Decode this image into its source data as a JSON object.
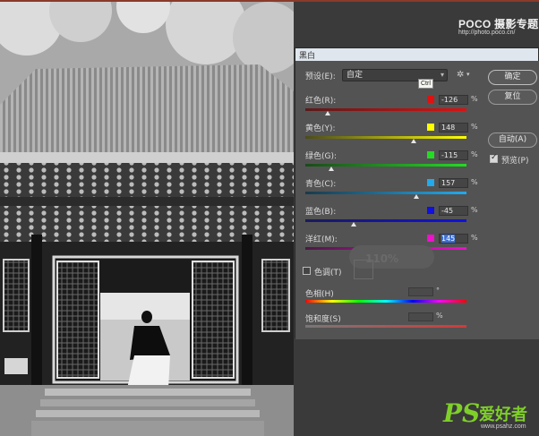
{
  "watermark": {
    "poco": "POCO 摄影专题",
    "url": "http://photo.poco.cn/",
    "ps_logo": "PS",
    "ps_cn": "爱好者",
    "ps_site": "www.psahz.com"
  },
  "dialog": {
    "title": "黑白",
    "preset_label": "预设(E):",
    "preset_value": "自定",
    "tooltip": "Ctrl",
    "buttons": {
      "ok": "确定",
      "reset": "复位",
      "auto": "自动(A)"
    },
    "preview_label": "预览(P)",
    "preview_checked": true,
    "sliders": [
      {
        "label": "红色(R):",
        "value": "-126",
        "unit": "%",
        "color": "#e01010",
        "level": 0.14
      },
      {
        "label": "黄色(Y):",
        "value": "148",
        "unit": "%",
        "color": "#ffff00",
        "level": 0.67
      },
      {
        "label": "绿色(G):",
        "value": "-115",
        "unit": "%",
        "color": "#22dd22",
        "level": 0.16
      },
      {
        "label": "青色(C):",
        "value": "157",
        "unit": "%",
        "color": "#22aaee",
        "level": 0.69
      },
      {
        "label": "蓝色(B):",
        "value": "-45",
        "unit": "%",
        "color": "#1010e0",
        "level": 0.3
      },
      {
        "label": "洋红(M):",
        "value": "145",
        "unit": "%",
        "color": "#ee10cc",
        "level": 0.66
      }
    ],
    "tint_label": "色调(T)",
    "ghost_text": "110%",
    "hue_label": "色相(H)",
    "hue_unit": "°",
    "saturation_label": "饱和度(S)",
    "saturation_unit": "%"
  }
}
